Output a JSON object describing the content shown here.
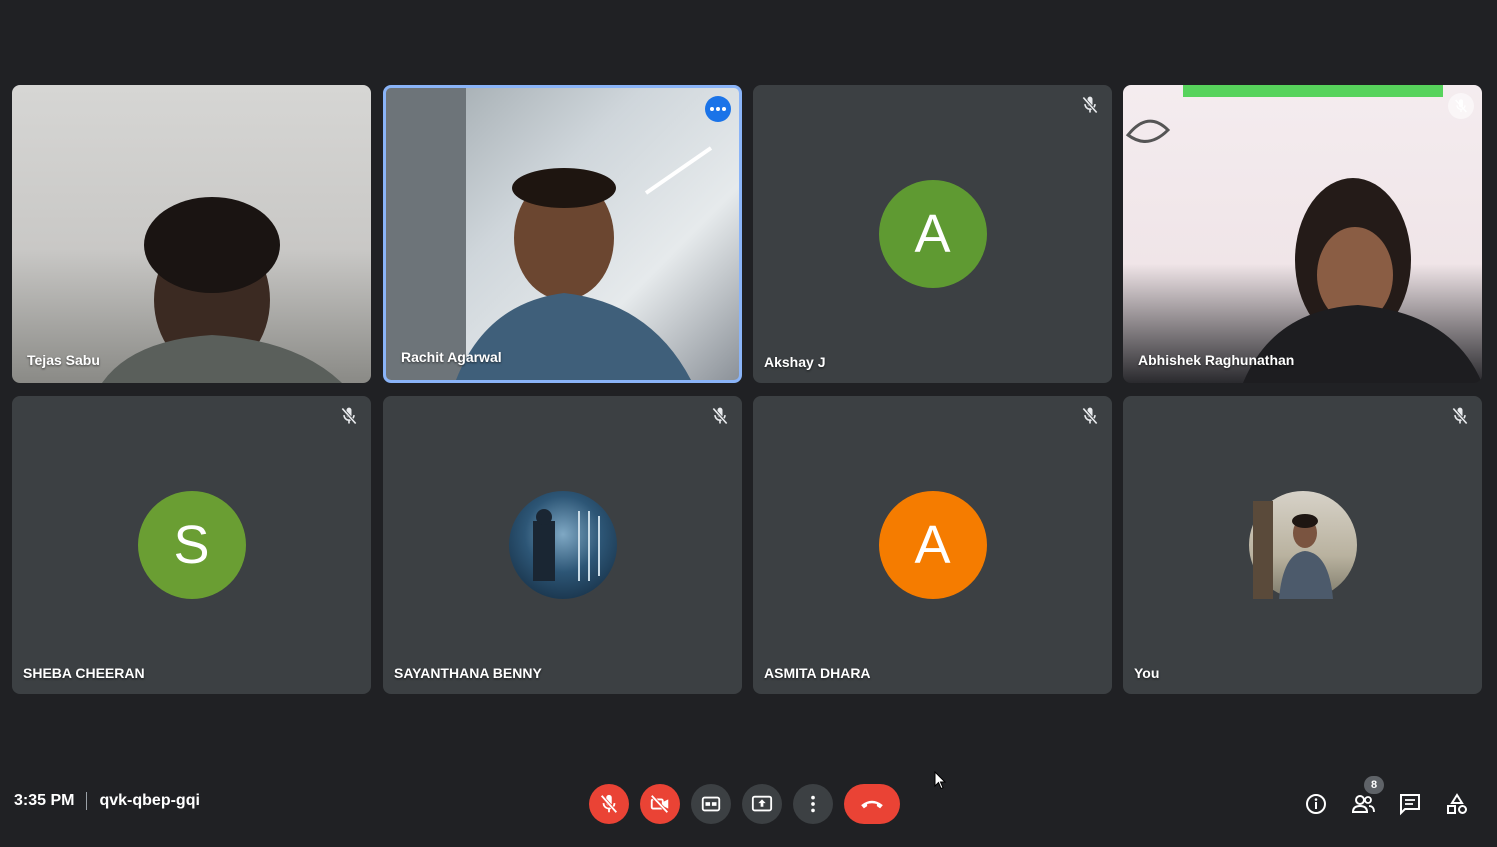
{
  "participants": [
    {
      "name": "Tejas Sabu",
      "type": "video"
    },
    {
      "name": "Rachit Agarwal",
      "type": "video",
      "active": true
    },
    {
      "name": "Akshay J",
      "type": "avatar",
      "initial": "A",
      "color": "#5f9a32",
      "muted": true
    },
    {
      "name": "Abhishek Raghunathan",
      "type": "video",
      "muted": true
    },
    {
      "name": "SHEBA CHEERAN",
      "type": "avatar",
      "initial": "S",
      "color": "#6a9e33",
      "muted": true
    },
    {
      "name": "SAYANTHANA BENNY",
      "type": "photo-avatar",
      "muted": true
    },
    {
      "name": "ASMITA DHARA",
      "type": "avatar",
      "initial": "A",
      "color": "#f57c00",
      "muted": true
    },
    {
      "name": "You",
      "type": "photo-avatar",
      "muted": true
    }
  ],
  "meeting": {
    "time": "3:35 PM",
    "code": "qvk-qbep-gqi"
  },
  "controls": {
    "participant_count": "8"
  },
  "colors": {
    "background": "#202124",
    "tile": "#3c4043",
    "danger": "#ea4335",
    "active_border": "#8ab4f8"
  }
}
